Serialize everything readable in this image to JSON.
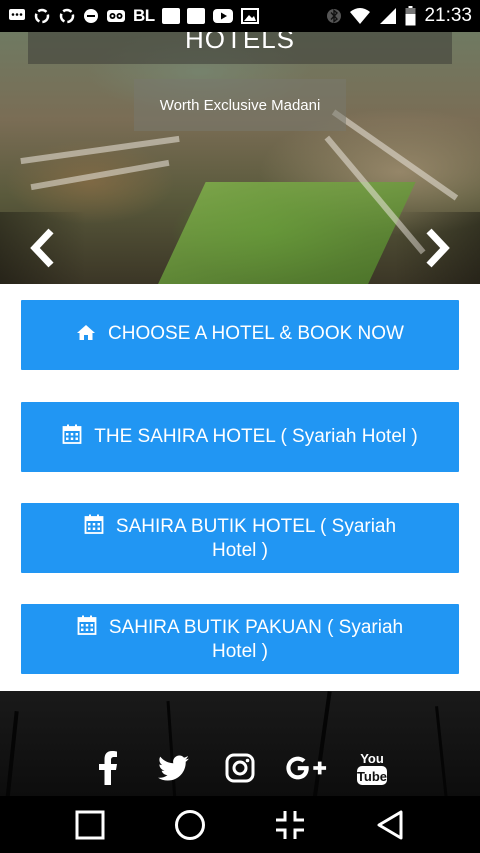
{
  "status_bar": {
    "carrier_text": "BL",
    "time": "21:33",
    "icons": [
      "chat-icon",
      "recycle-icon",
      "recycle-icon",
      "app-icon",
      "tripadvisor-icon",
      "square-icon",
      "square-icon",
      "youtube-icon",
      "image-icon",
      "bluetooth-icon",
      "wifi-icon",
      "signal-icon",
      "battery-icon"
    ]
  },
  "hero": {
    "title": "HOTELS",
    "subtitle": "Worth Exclusive Madani"
  },
  "buttons": [
    {
      "label": "CHOOSE A HOTEL & BOOK NOW",
      "icon": "home-icon"
    },
    {
      "label": "THE SAHIRA HOTEL ( Syariah Hotel )",
      "icon": "calendar-icon"
    },
    {
      "label": "SAHIRA BUTIK HOTEL ( Syariah Hotel )",
      "icon": "calendar-icon"
    },
    {
      "label": "SAHIRA BUTIK PAKUAN ( Syariah Hotel )",
      "icon": "calendar-icon"
    }
  ],
  "social": [
    "facebook-icon",
    "twitter-icon",
    "instagram-icon",
    "google-plus-icon",
    "youtube-icon"
  ],
  "colors": {
    "button": "#2196f3",
    "status_bar": "#000000",
    "footer": "#111111"
  }
}
